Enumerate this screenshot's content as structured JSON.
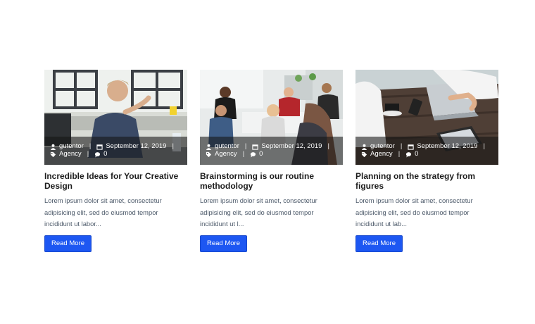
{
  "posts": [
    {
      "author": "gutentor",
      "date": "September 12, 2019",
      "category": "Agency",
      "comments": "0",
      "title": "Incredible Ideas for Your Creative Design",
      "excerpt": "Lorem ipsum dolor sit amet, consectetur adipisicing elit, sed do eiusmod tempor incididunt ut labor...",
      "button": "Read More"
    },
    {
      "author": "gutentor",
      "date": "September 12, 2019",
      "category": "Agency",
      "comments": "0",
      "title": "Brainstorming is our routine methodology",
      "excerpt": "Lorem ipsum dolor sit amet, consectetur adipisicing elit, sed do eiusmod tempor incididunt ut l...",
      "button": "Read More"
    },
    {
      "author": "gutentor",
      "date": "September 12, 2019",
      "category": "Agency",
      "comments": "0",
      "title": "Planning on the strategy from figures",
      "excerpt": "Lorem ipsum dolor sit amet, consectetur adipisicing elit, sed do eiusmod tempor incididunt ut lab...",
      "button": "Read More"
    }
  ],
  "colors": {
    "button": "#1d57f2",
    "excerpt": "#4d5a6a",
    "overlay": "rgba(20,20,20,0.58)"
  },
  "icons": {
    "author": "user-icon",
    "date": "calendar-icon",
    "category": "tag-icon",
    "comments": "comment-icon"
  }
}
